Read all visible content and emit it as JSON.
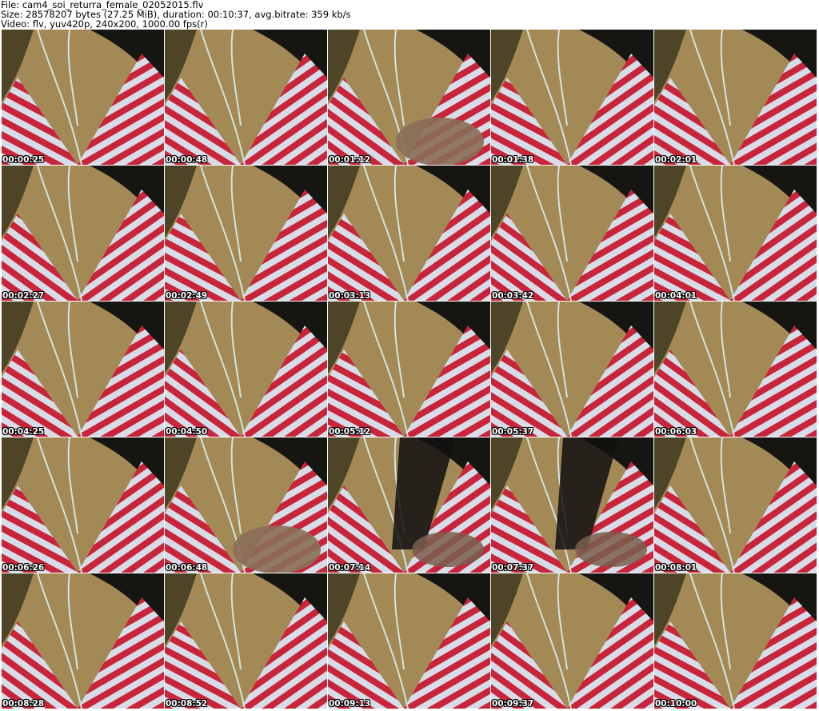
{
  "header": {
    "file_line": "File: cam4_soi_returra_female_02052015.flv",
    "size_line": "Size: 28578207 bytes (27.25 MiB), duration: 00:10:37, avg.bitrate: 359 kb/s",
    "video_line": "Video: flv, yuv420p, 240x200, 1000.00 fps(r)"
  },
  "colors": {
    "stripe_red": "#c8243a",
    "stripe_light": "#d7dde8",
    "skin": "#b99a62",
    "hair": "#151612",
    "background": "#2b2a14"
  },
  "thumbnails": [
    {
      "timestamp": "00:00:25",
      "variant": "normal"
    },
    {
      "timestamp": "00:00:48",
      "variant": "normal"
    },
    {
      "timestamp": "00:01:12",
      "variant": "hand"
    },
    {
      "timestamp": "00:01:38",
      "variant": "normal"
    },
    {
      "timestamp": "00:02:01",
      "variant": "normal"
    },
    {
      "timestamp": "00:02:27",
      "variant": "normal"
    },
    {
      "timestamp": "00:02:49",
      "variant": "normal"
    },
    {
      "timestamp": "00:03:13",
      "variant": "normal"
    },
    {
      "timestamp": "00:03:42",
      "variant": "normal"
    },
    {
      "timestamp": "00:04:01",
      "variant": "normal"
    },
    {
      "timestamp": "00:04:25",
      "variant": "normal"
    },
    {
      "timestamp": "00:04:50",
      "variant": "normal"
    },
    {
      "timestamp": "00:05:12",
      "variant": "normal"
    },
    {
      "timestamp": "00:05:37",
      "variant": "normal"
    },
    {
      "timestamp": "00:06:03",
      "variant": "normal"
    },
    {
      "timestamp": "00:06:26",
      "variant": "normal"
    },
    {
      "timestamp": "00:06:48",
      "variant": "hand"
    },
    {
      "timestamp": "00:07:14",
      "variant": "object"
    },
    {
      "timestamp": "00:07:37",
      "variant": "object"
    },
    {
      "timestamp": "00:08:01",
      "variant": "normal"
    },
    {
      "timestamp": "00:08:28",
      "variant": "normal"
    },
    {
      "timestamp": "00:08:52",
      "variant": "normal"
    },
    {
      "timestamp": "00:09:13",
      "variant": "normal"
    },
    {
      "timestamp": "00:09:37",
      "variant": "normal"
    },
    {
      "timestamp": "00:10:00",
      "variant": "normal"
    }
  ]
}
